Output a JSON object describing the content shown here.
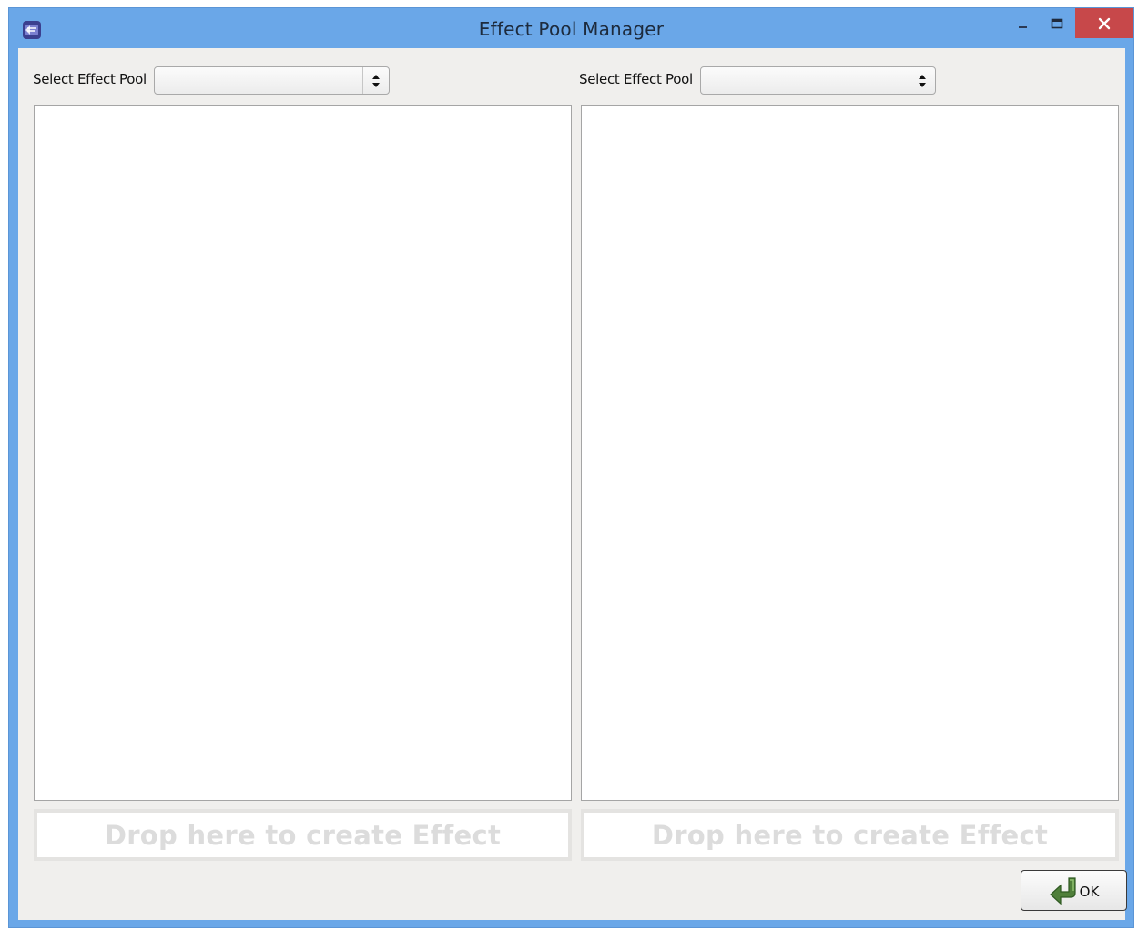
{
  "window": {
    "title": "Effect Pool Manager"
  },
  "left_panel": {
    "select_label": "Select Effect Pool",
    "selected_value": "",
    "drop_zone_label": "Drop here to create Effect"
  },
  "right_panel": {
    "select_label": "Select Effect Pool",
    "selected_value": "",
    "drop_zone_label": "Drop here to create Effect"
  },
  "footer": {
    "ok_label": "OK"
  },
  "colors": {
    "titlebar": "#6aa7e8",
    "close_button": "#c7484a",
    "client_background": "#f0efed",
    "drop_text": "#dcdcdc",
    "ok_icon": "#4f7f3a"
  },
  "icons": {
    "app": "app-icon",
    "minimize": "minimize-icon",
    "maximize": "maximize-icon",
    "close": "close-icon",
    "ok": "green-return-arrow-icon"
  }
}
